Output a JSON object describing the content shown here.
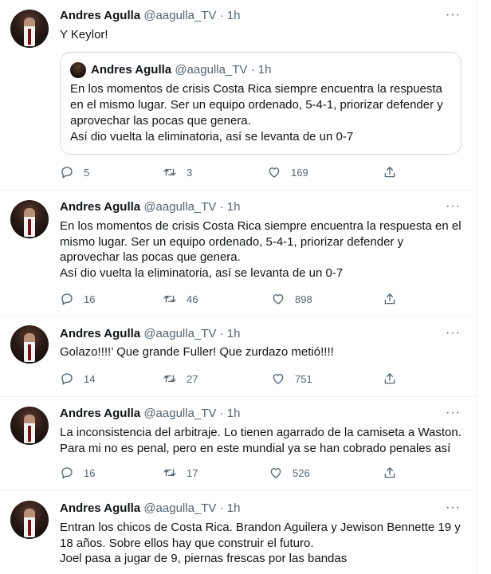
{
  "tweets": [
    {
      "name": "Andres Agulla",
      "handle": "@aagulla_TV",
      "sep": "·",
      "time": "1h",
      "more": "···",
      "lines": [
        "Y Keylor!"
      ],
      "quote": {
        "name": "Andres Agulla",
        "handle": "@aagulla_TV",
        "sep": "·",
        "time": "1h",
        "lines": [
          "En los momentos de crisis Costa Rica siempre encuentra la respuesta",
          "en el mismo lugar. Ser un equipo ordenado, 5-4-1, priorizar defender y",
          "aprovechar las pocas que genera.",
          "Así dio vuelta la eliminatoria, así se levanta de un 0-7"
        ]
      },
      "replies": "5",
      "retweets": "3",
      "likes": "169"
    },
    {
      "name": "Andres Agulla",
      "handle": "@aagulla_TV",
      "sep": "·",
      "time": "1h",
      "more": "···",
      "lines": [
        "En los momentos de crisis Costa Rica siempre encuentra la respuesta en el",
        "mismo lugar. Ser un equipo ordenado, 5-4-1, priorizar defender y",
        "aprovechar las pocas que genera.",
        "Así dio vuelta la eliminatoria, así se levanta de un 0-7"
      ],
      "replies": "16",
      "retweets": "46",
      "likes": "898"
    },
    {
      "name": "Andres Agulla",
      "handle": "@aagulla_TV",
      "sep": "·",
      "time": "1h",
      "more": "···",
      "lines": [
        "Golazo!!!!’ Que grande Fuller! Que zurdazo metió!!!!"
      ],
      "replies": "14",
      "retweets": "27",
      "likes": "751"
    },
    {
      "name": "Andres Agulla",
      "handle": "@aagulla_TV",
      "sep": "·",
      "time": "1h",
      "more": "···",
      "lines": [
        "La inconsistencia del arbitraje. Lo tienen agarrado de la camiseta a Waston.",
        "Para mi no es penal, pero en este mundial ya se han cobrado penales así"
      ],
      "replies": "16",
      "retweets": "17",
      "likes": "526"
    },
    {
      "name": "Andres Agulla",
      "handle": "@aagulla_TV",
      "sep": "·",
      "time": "1h",
      "more": "···",
      "lines": [
        "Entran los chicos de Costa Rica. Brandon Aguilera y Jewison Bennette 19 y",
        "18 años. Sobre ellos hay que construir el futuro.",
        "Joel pasa a jugar de 9, piernas frescas por las bandas"
      ]
    }
  ]
}
